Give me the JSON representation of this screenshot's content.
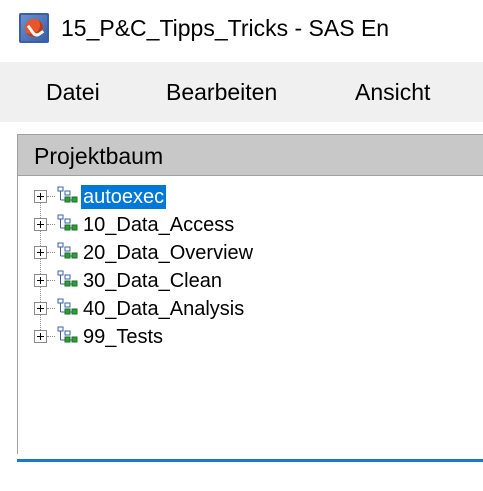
{
  "window": {
    "title": "15_P&C_Tipps_Tricks - SAS En",
    "icon": "sas-enterprise-guide-icon"
  },
  "menubar": {
    "items": [
      {
        "label": "Datei"
      },
      {
        "label": "Bearbeiten"
      },
      {
        "label": "Ansicht"
      }
    ]
  },
  "panel": {
    "title": "Projektbaum",
    "tree": [
      {
        "label": "autoexec",
        "selected": true
      },
      {
        "label": "10_Data_Access",
        "selected": false
      },
      {
        "label": "20_Data_Overview",
        "selected": false
      },
      {
        "label": "30_Data_Clean",
        "selected": false
      },
      {
        "label": "40_Data_Analysis",
        "selected": false
      },
      {
        "label": "99_Tests",
        "selected": false
      }
    ]
  },
  "colors": {
    "selection": "#0078d7",
    "panel_header": "#c8c8c8",
    "menubar": "#f0f0f0",
    "accent_line": "#1979ca",
    "node_icon_green": "#2e9e3a",
    "node_icon_blue": "#3a5fa8"
  }
}
